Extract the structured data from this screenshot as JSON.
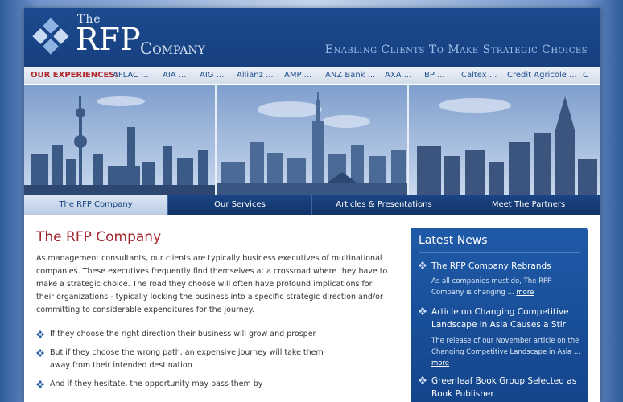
{
  "header": {
    "logo_the": "The",
    "logo_rfp": "RFP",
    "logo_company": "Company",
    "tagline": "Enabling Clients To Make Strategic Choices"
  },
  "experiences": {
    "label": "OUR EXPERIENCES:",
    "items": [
      "AFLAC ...",
      "AIA ...",
      "AIG ...",
      "Allianz ...",
      "AMP ...",
      "ANZ Bank ...",
      "AXA ...",
      "BP ...",
      "Caltex ...",
      "Credit Agricole ...",
      "C"
    ]
  },
  "nav": {
    "tabs": [
      {
        "label": "The RFP Company",
        "active": true
      },
      {
        "label": "Our Services",
        "active": false
      },
      {
        "label": "Articles & Presentations",
        "active": false
      },
      {
        "label": "Meet The Partners",
        "active": false
      }
    ]
  },
  "main": {
    "title": "The RFP Company",
    "intro": "As management consultants, our clients are typically business executives of multinational companies. These executives frequently find themselves at a crossroad where they have to make a strategic choice. The road they choose will often have profound implications for their organizations - typically locking the business into a specific strategic direction and/or committing to considerable expenditures for the journey.",
    "bullets": [
      "If they choose the right direction their business will grow and prosper",
      "But if they choose the wrong path, an expensive journey will take them away from their intended destination",
      "And if they hesitate, the opportunity may pass them by"
    ]
  },
  "news": {
    "title": "Latest News",
    "items": [
      {
        "headline": "The RFP Company Rebrands",
        "body": "As all companies must do, The RFP Company is changing ...",
        "more": "more"
      },
      {
        "headline": "Article on Changing Competitive Landscape in Asia Causes a Stir",
        "body": "The release of our November article on the Changing Competitive Landscape in Asia ...",
        "more": "more"
      },
      {
        "headline": "Greenleaf Book Group Selected as Book Publisher",
        "body": "",
        "more": ""
      }
    ]
  },
  "colors": {
    "header_blue": "#1d4b8f",
    "accent_red": "#a3252b",
    "nav_active": "#dbe5f3",
    "news_panel": "#1f5aa8"
  }
}
